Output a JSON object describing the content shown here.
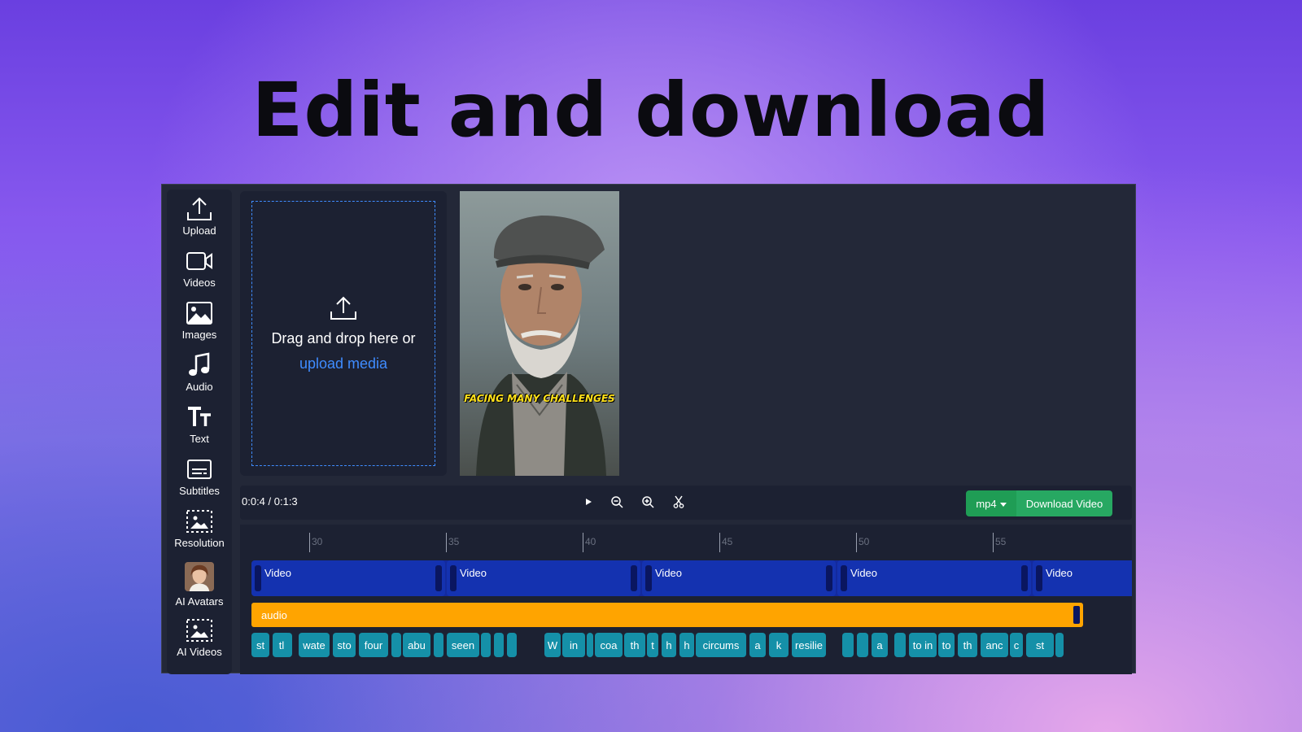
{
  "headline": "Edit and download",
  "sidebar": {
    "items": [
      {
        "label": "Upload",
        "icon": "upload-icon"
      },
      {
        "label": "Videos",
        "icon": "video-camera-icon"
      },
      {
        "label": "Images",
        "icon": "image-icon"
      },
      {
        "label": "Audio",
        "icon": "music-note-icon"
      },
      {
        "label": "Text",
        "icon": "text-icon"
      },
      {
        "label": "Subtitles",
        "icon": "subtitles-icon"
      },
      {
        "label": "Resolution",
        "icon": "resolution-icon"
      },
      {
        "label": "AI Avatars",
        "icon": "avatar-thumbnail"
      },
      {
        "label": "AI Videos",
        "icon": "ai-video-icon"
      }
    ]
  },
  "dropzone": {
    "text": "Drag and drop here or",
    "link": "upload media"
  },
  "preview": {
    "caption": "FACING MANY CHALLENGES"
  },
  "toolbar": {
    "timecode": "0:0:4 / 0:1:3",
    "format": "mp4",
    "download_label": "Download Video"
  },
  "timeline": {
    "ruler": [
      "30",
      "35",
      "40",
      "45",
      "50",
      "55"
    ],
    "video_clips": [
      "Video",
      "Video",
      "Video",
      "Video",
      "Video"
    ],
    "audio_label": "audio",
    "subtitle_chips": [
      "st",
      "tl",
      "",
      "wate",
      "sto",
      "four",
      "",
      "abu",
      "",
      "seen",
      "",
      "",
      "",
      "W",
      "in",
      "",
      "coa",
      "th",
      "t",
      "h",
      "h",
      "circums",
      "a",
      "k",
      "resilie",
      "",
      "",
      "a",
      "",
      "to in",
      "to",
      "th",
      "anc",
      "c",
      "st",
      ""
    ]
  },
  "colors": {
    "accent_blue": "#3f8cff",
    "video_track": "#1432b0",
    "audio_track": "#ffa400",
    "subtitle_chip": "#1590a8",
    "download_green": "#27a862"
  }
}
